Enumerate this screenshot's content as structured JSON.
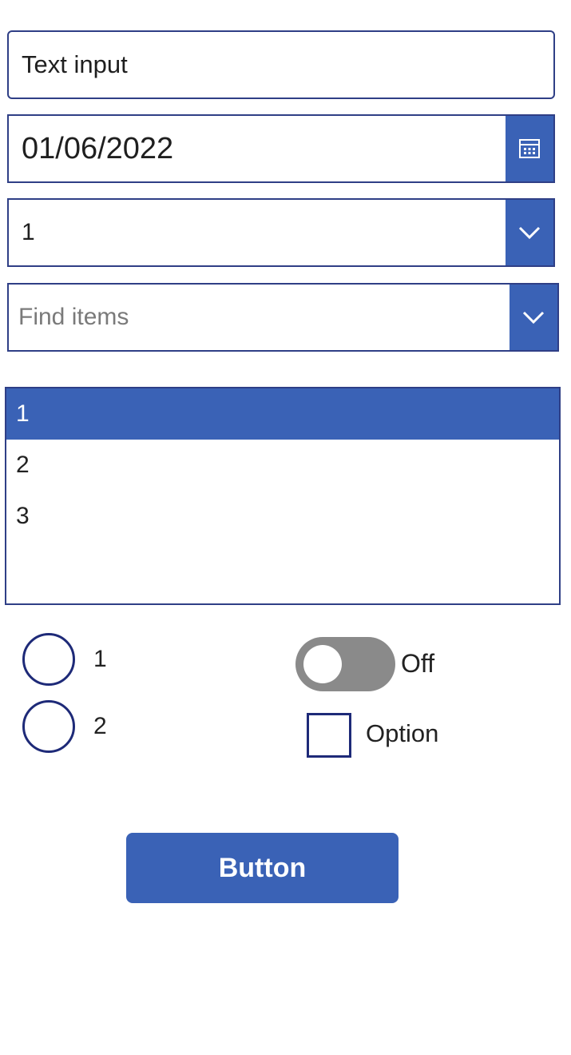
{
  "text_input": {
    "value": "Text input"
  },
  "date_picker": {
    "value": "01/06/2022",
    "icon": "calendar-icon"
  },
  "dropdown": {
    "value": "1",
    "icon": "chevron-down-icon"
  },
  "combobox": {
    "placeholder": "Find items",
    "icon": "chevron-down-icon"
  },
  "listbox": {
    "items": [
      {
        "label": "1",
        "selected": true
      },
      {
        "label": "2",
        "selected": false
      },
      {
        "label": "3",
        "selected": false
      }
    ]
  },
  "radio": {
    "options": [
      {
        "label": "1",
        "checked": false
      },
      {
        "label": "2",
        "checked": false
      }
    ]
  },
  "toggle": {
    "label": "Off",
    "on": false
  },
  "checkbox": {
    "label": "Option",
    "checked": false
  },
  "button": {
    "label": "Button"
  },
  "colors": {
    "accent": "#3a62b6",
    "border": "#2f3f86",
    "toggle_off": "#8a8a8a",
    "placeholder": "#7a7a7a"
  }
}
